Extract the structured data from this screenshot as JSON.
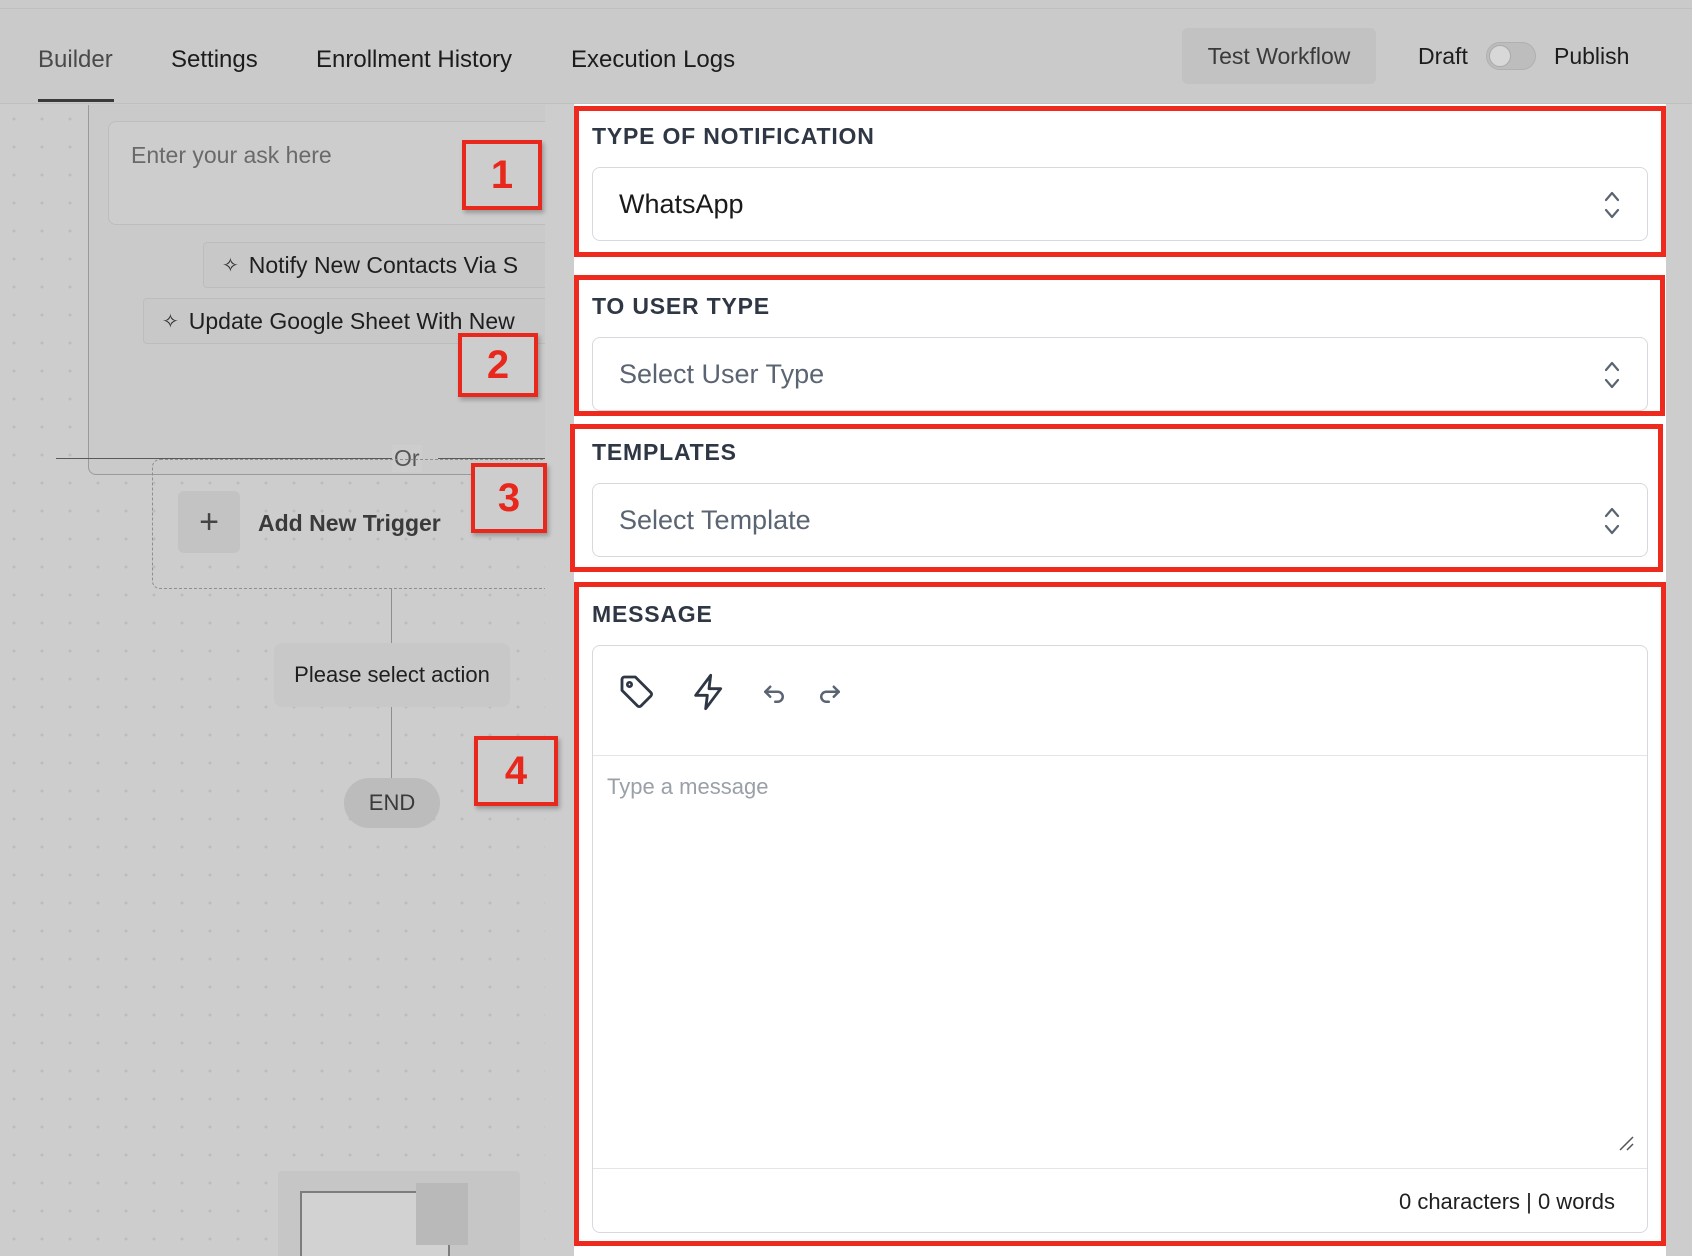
{
  "tabs": [
    {
      "label": "Builder"
    },
    {
      "label": "Settings"
    },
    {
      "label": "Enrollment History"
    },
    {
      "label": "Execution Logs"
    }
  ],
  "header": {
    "test_button": "Test Workflow",
    "draft_label": "Draft",
    "publish_label": "Publish",
    "toggle_on": false
  },
  "canvas": {
    "ask_placeholder": "Enter your ask here",
    "suggestions": [
      {
        "label": "Notify New Contacts Via S",
        "icon": "sparkle-icon"
      },
      {
        "label": "Update Google Sheet With New",
        "icon": "sparkle-icon"
      }
    ],
    "or_label": "Or",
    "add_trigger_label": "Add New Trigger",
    "select_action_label": "Please select action",
    "end_label": "END"
  },
  "annotations": [
    "1",
    "2",
    "3",
    "4"
  ],
  "panel": {
    "notification_type": {
      "label": "TYPE OF NOTIFICATION",
      "value": "WhatsApp"
    },
    "user_type": {
      "label": "TO USER TYPE",
      "placeholder": "Select User Type"
    },
    "templates": {
      "label": "TEMPLATES",
      "placeholder": "Select Template"
    },
    "message": {
      "label": "MESSAGE",
      "placeholder": "Type a message",
      "counter": "0 characters | 0 words",
      "toolbar_icons": [
        "tag-icon",
        "lightning-icon",
        "undo-icon",
        "redo-icon"
      ]
    }
  },
  "colors": {
    "annotation_red": "#ee2a1f",
    "label_text": "#2f3745"
  }
}
